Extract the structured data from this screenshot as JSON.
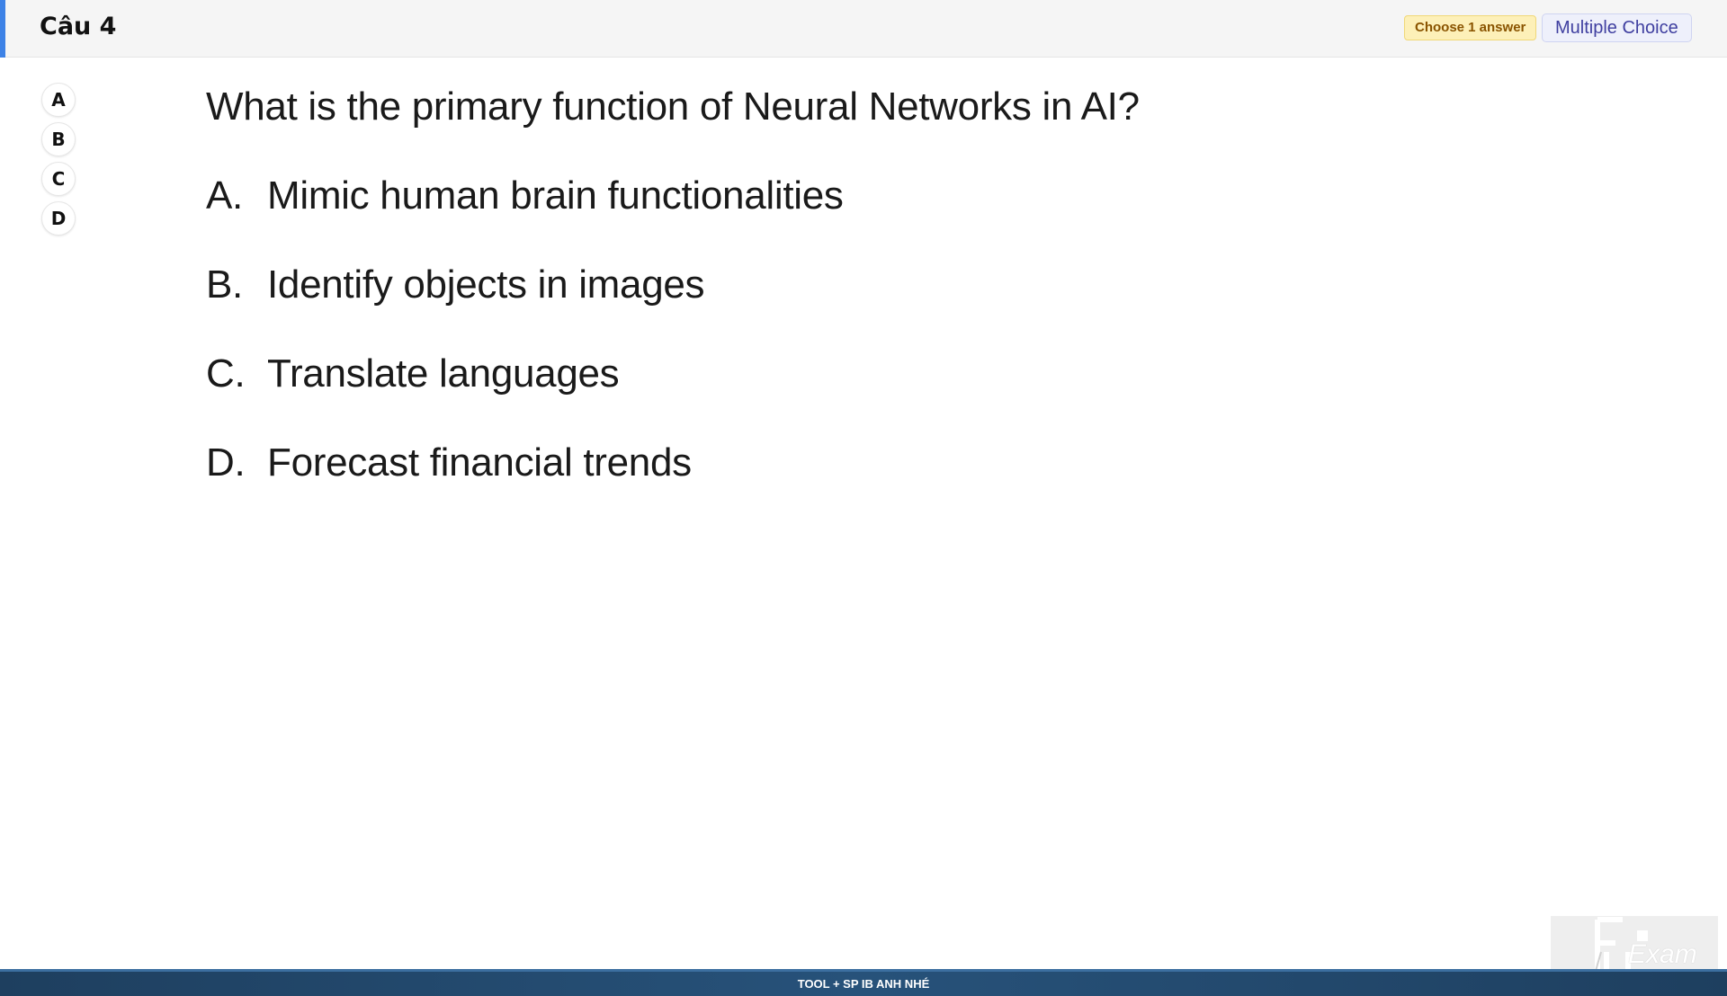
{
  "header": {
    "title": "Câu 4",
    "choose_badge": "Choose 1 answer",
    "type_badge": "Multiple Choice"
  },
  "answer_buttons": [
    "A",
    "B",
    "C",
    "D"
  ],
  "question": {
    "text": "What is the primary function of Neural Networks in AI?",
    "options": [
      {
        "letter": "A.",
        "text": "Mimic human brain functionalities"
      },
      {
        "letter": "B.",
        "text": "Identify objects in images"
      },
      {
        "letter": "C.",
        "text": "Translate languages"
      },
      {
        "letter": "D.",
        "text": "Forecast financial trends"
      }
    ]
  },
  "footer": {
    "text": "TOOL + SP IB ANH NHÉ"
  },
  "logo": {
    "text": "Exam",
    "icon": "fu-exam-logo"
  },
  "colors": {
    "accent": "#3d82e6",
    "choose_badge_bg": "#fdf0b8",
    "type_badge_bg": "#eef0fb",
    "footer_bg": "#1e3f5f"
  }
}
